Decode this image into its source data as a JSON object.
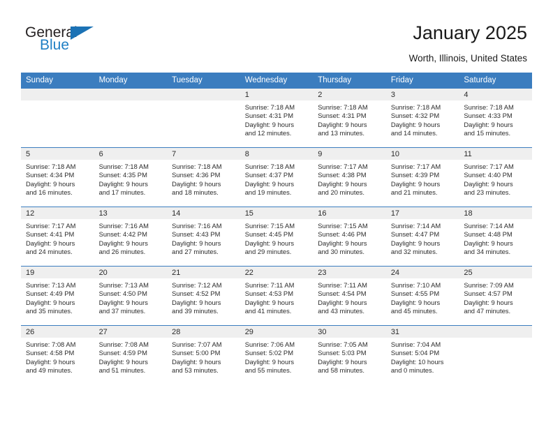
{
  "brand": {
    "name_top": "General",
    "name_bottom": "Blue",
    "triangle_icon": "triangle-icon",
    "color_top": "#231f20",
    "color_bottom": "#1f7fc4",
    "triangle_color": "#1b72b5"
  },
  "header": {
    "title": "January 2025",
    "subtitle": "Worth, Illinois, United States"
  },
  "theme": {
    "header_row_bg": "#3b7dbf",
    "daynum_band_bg": "#efefef",
    "cell_bg": "#ffffff",
    "text_color": "#2b2b2b"
  },
  "columns": [
    "Sunday",
    "Monday",
    "Tuesday",
    "Wednesday",
    "Thursday",
    "Friday",
    "Saturday"
  ],
  "weeks": [
    [
      {
        "empty": true
      },
      {
        "empty": true
      },
      {
        "empty": true
      },
      {
        "day": "1",
        "sunrise": "Sunrise: 7:18 AM",
        "sunset": "Sunset: 4:31 PM",
        "daylight1": "Daylight: 9 hours",
        "daylight2": "and 12 minutes."
      },
      {
        "day": "2",
        "sunrise": "Sunrise: 7:18 AM",
        "sunset": "Sunset: 4:31 PM",
        "daylight1": "Daylight: 9 hours",
        "daylight2": "and 13 minutes."
      },
      {
        "day": "3",
        "sunrise": "Sunrise: 7:18 AM",
        "sunset": "Sunset: 4:32 PM",
        "daylight1": "Daylight: 9 hours",
        "daylight2": "and 14 minutes."
      },
      {
        "day": "4",
        "sunrise": "Sunrise: 7:18 AM",
        "sunset": "Sunset: 4:33 PM",
        "daylight1": "Daylight: 9 hours",
        "daylight2": "and 15 minutes."
      }
    ],
    [
      {
        "day": "5",
        "sunrise": "Sunrise: 7:18 AM",
        "sunset": "Sunset: 4:34 PM",
        "daylight1": "Daylight: 9 hours",
        "daylight2": "and 16 minutes."
      },
      {
        "day": "6",
        "sunrise": "Sunrise: 7:18 AM",
        "sunset": "Sunset: 4:35 PM",
        "daylight1": "Daylight: 9 hours",
        "daylight2": "and 17 minutes."
      },
      {
        "day": "7",
        "sunrise": "Sunrise: 7:18 AM",
        "sunset": "Sunset: 4:36 PM",
        "daylight1": "Daylight: 9 hours",
        "daylight2": "and 18 minutes."
      },
      {
        "day": "8",
        "sunrise": "Sunrise: 7:18 AM",
        "sunset": "Sunset: 4:37 PM",
        "daylight1": "Daylight: 9 hours",
        "daylight2": "and 19 minutes."
      },
      {
        "day": "9",
        "sunrise": "Sunrise: 7:17 AM",
        "sunset": "Sunset: 4:38 PM",
        "daylight1": "Daylight: 9 hours",
        "daylight2": "and 20 minutes."
      },
      {
        "day": "10",
        "sunrise": "Sunrise: 7:17 AM",
        "sunset": "Sunset: 4:39 PM",
        "daylight1": "Daylight: 9 hours",
        "daylight2": "and 21 minutes."
      },
      {
        "day": "11",
        "sunrise": "Sunrise: 7:17 AM",
        "sunset": "Sunset: 4:40 PM",
        "daylight1": "Daylight: 9 hours",
        "daylight2": "and 23 minutes."
      }
    ],
    [
      {
        "day": "12",
        "sunrise": "Sunrise: 7:17 AM",
        "sunset": "Sunset: 4:41 PM",
        "daylight1": "Daylight: 9 hours",
        "daylight2": "and 24 minutes."
      },
      {
        "day": "13",
        "sunrise": "Sunrise: 7:16 AM",
        "sunset": "Sunset: 4:42 PM",
        "daylight1": "Daylight: 9 hours",
        "daylight2": "and 26 minutes."
      },
      {
        "day": "14",
        "sunrise": "Sunrise: 7:16 AM",
        "sunset": "Sunset: 4:43 PM",
        "daylight1": "Daylight: 9 hours",
        "daylight2": "and 27 minutes."
      },
      {
        "day": "15",
        "sunrise": "Sunrise: 7:15 AM",
        "sunset": "Sunset: 4:45 PM",
        "daylight1": "Daylight: 9 hours",
        "daylight2": "and 29 minutes."
      },
      {
        "day": "16",
        "sunrise": "Sunrise: 7:15 AM",
        "sunset": "Sunset: 4:46 PM",
        "daylight1": "Daylight: 9 hours",
        "daylight2": "and 30 minutes."
      },
      {
        "day": "17",
        "sunrise": "Sunrise: 7:14 AM",
        "sunset": "Sunset: 4:47 PM",
        "daylight1": "Daylight: 9 hours",
        "daylight2": "and 32 minutes."
      },
      {
        "day": "18",
        "sunrise": "Sunrise: 7:14 AM",
        "sunset": "Sunset: 4:48 PM",
        "daylight1": "Daylight: 9 hours",
        "daylight2": "and 34 minutes."
      }
    ],
    [
      {
        "day": "19",
        "sunrise": "Sunrise: 7:13 AM",
        "sunset": "Sunset: 4:49 PM",
        "daylight1": "Daylight: 9 hours",
        "daylight2": "and 35 minutes."
      },
      {
        "day": "20",
        "sunrise": "Sunrise: 7:13 AM",
        "sunset": "Sunset: 4:50 PM",
        "daylight1": "Daylight: 9 hours",
        "daylight2": "and 37 minutes."
      },
      {
        "day": "21",
        "sunrise": "Sunrise: 7:12 AM",
        "sunset": "Sunset: 4:52 PM",
        "daylight1": "Daylight: 9 hours",
        "daylight2": "and 39 minutes."
      },
      {
        "day": "22",
        "sunrise": "Sunrise: 7:11 AM",
        "sunset": "Sunset: 4:53 PM",
        "daylight1": "Daylight: 9 hours",
        "daylight2": "and 41 minutes."
      },
      {
        "day": "23",
        "sunrise": "Sunrise: 7:11 AM",
        "sunset": "Sunset: 4:54 PM",
        "daylight1": "Daylight: 9 hours",
        "daylight2": "and 43 minutes."
      },
      {
        "day": "24",
        "sunrise": "Sunrise: 7:10 AM",
        "sunset": "Sunset: 4:55 PM",
        "daylight1": "Daylight: 9 hours",
        "daylight2": "and 45 minutes."
      },
      {
        "day": "25",
        "sunrise": "Sunrise: 7:09 AM",
        "sunset": "Sunset: 4:57 PM",
        "daylight1": "Daylight: 9 hours",
        "daylight2": "and 47 minutes."
      }
    ],
    [
      {
        "day": "26",
        "sunrise": "Sunrise: 7:08 AM",
        "sunset": "Sunset: 4:58 PM",
        "daylight1": "Daylight: 9 hours",
        "daylight2": "and 49 minutes."
      },
      {
        "day": "27",
        "sunrise": "Sunrise: 7:08 AM",
        "sunset": "Sunset: 4:59 PM",
        "daylight1": "Daylight: 9 hours",
        "daylight2": "and 51 minutes."
      },
      {
        "day": "28",
        "sunrise": "Sunrise: 7:07 AM",
        "sunset": "Sunset: 5:00 PM",
        "daylight1": "Daylight: 9 hours",
        "daylight2": "and 53 minutes."
      },
      {
        "day": "29",
        "sunrise": "Sunrise: 7:06 AM",
        "sunset": "Sunset: 5:02 PM",
        "daylight1": "Daylight: 9 hours",
        "daylight2": "and 55 minutes."
      },
      {
        "day": "30",
        "sunrise": "Sunrise: 7:05 AM",
        "sunset": "Sunset: 5:03 PM",
        "daylight1": "Daylight: 9 hours",
        "daylight2": "and 58 minutes."
      },
      {
        "day": "31",
        "sunrise": "Sunrise: 7:04 AM",
        "sunset": "Sunset: 5:04 PM",
        "daylight1": "Daylight: 10 hours",
        "daylight2": "and 0 minutes."
      },
      {
        "empty": true
      }
    ]
  ]
}
